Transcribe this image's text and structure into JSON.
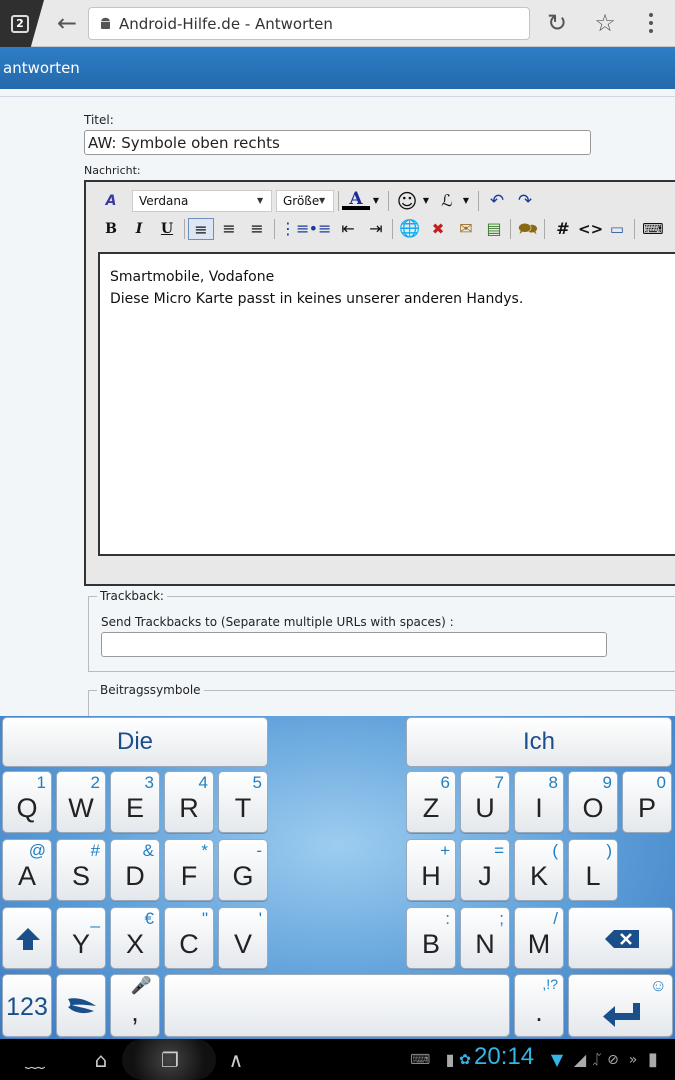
{
  "browser": {
    "tab_count": "2",
    "url_title": "Android-Hilfe.de - Antworten",
    "icons": [
      "tabs-icon",
      "back-arrow-icon",
      "android-icon",
      "reload-icon",
      "star-icon",
      "overflow-menu-icon"
    ]
  },
  "site": {
    "header_text": "antworten"
  },
  "form": {
    "title_label": "Titel:",
    "title_value": "AW: Symbole oben rechts",
    "message_label": "Nachricht:",
    "font_select": "Verdana",
    "size_select": "Größe",
    "message_lines": [
      "Smartmobile, Vodafone",
      "Diese Micro Karte passt in keines unserer anderen Handys."
    ],
    "trackback_legend": "Trackback:",
    "trackback_label": "Send Trackbacks to (Separate multiple URLs with spaces) :",
    "trackback_value": "",
    "symbols_legend": "Beitragssymbole"
  },
  "keyboard": {
    "suggestions": [
      "Die",
      "Ich"
    ],
    "row1": [
      {
        "m": "Q",
        "s": "1"
      },
      {
        "m": "W",
        "s": "2"
      },
      {
        "m": "E",
        "s": "3"
      },
      {
        "m": "R",
        "s": "4"
      },
      {
        "m": "T",
        "s": "5"
      },
      {
        "m": "Z",
        "s": "6"
      },
      {
        "m": "U",
        "s": "7"
      },
      {
        "m": "I",
        "s": "8"
      },
      {
        "m": "O",
        "s": "9"
      },
      {
        "m": "P",
        "s": "0"
      }
    ],
    "row2": [
      {
        "m": "A",
        "s": "@"
      },
      {
        "m": "S",
        "s": "#"
      },
      {
        "m": "D",
        "s": "&"
      },
      {
        "m": "F",
        "s": "*"
      },
      {
        "m": "G",
        "s": "-"
      },
      {
        "m": "H",
        "s": "+"
      },
      {
        "m": "J",
        "s": "="
      },
      {
        "m": "K",
        "s": "("
      },
      {
        "m": "L",
        "s": ")"
      }
    ],
    "row3": [
      {
        "m": "Y",
        "s": "_"
      },
      {
        "m": "X",
        "s": "€"
      },
      {
        "m": "C",
        "s": "\""
      },
      {
        "m": "V",
        "s": "'"
      },
      {
        "m": "B",
        "s": ":"
      },
      {
        "m": "N",
        "s": ";"
      },
      {
        "m": "M",
        "s": "/"
      }
    ],
    "numbers_key": "123",
    "comma_key": ",",
    "period_key": ".",
    "period_alt": ",!?"
  },
  "status": {
    "clock": "20:14"
  }
}
